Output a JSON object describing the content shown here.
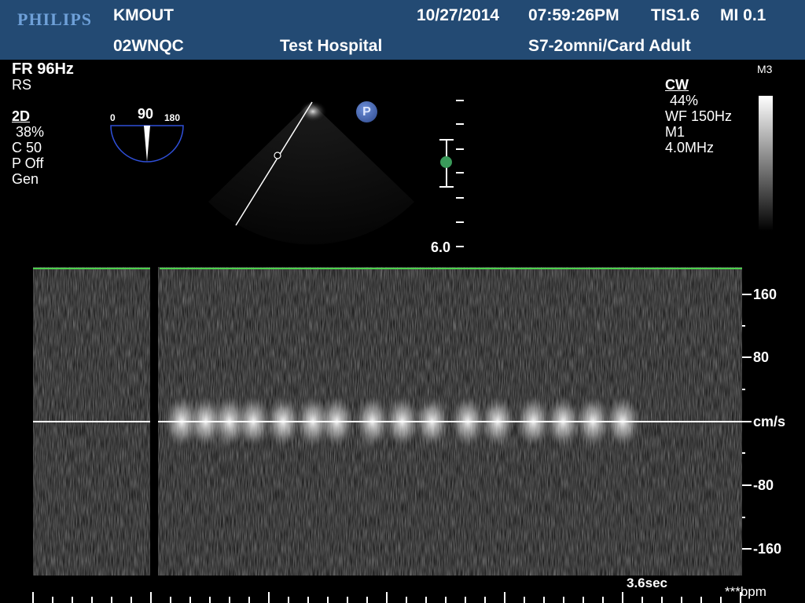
{
  "header": {
    "brand": "PHILIPS",
    "patient_id": "KMOUT",
    "exam_id": "02WNQC",
    "hospital": "Test Hospital",
    "date": "10/27/2014",
    "time": "07:59:26PM",
    "tis": "TIS1.6",
    "mi": "MI 0.1",
    "probe_preset": "S7-2omni/Card Adult"
  },
  "left_panel": {
    "frame_rate": "FR 96Hz",
    "rs": "RS",
    "mode": "2D",
    "gain": "38%",
    "compression": "C 50",
    "persistence": "P Off",
    "resolution": "Gen"
  },
  "angle_indicator": {
    "min": "0",
    "value": "90",
    "max": "180"
  },
  "markers": {
    "p_badge": "P",
    "depth": "6.0",
    "map": "M3"
  },
  "right_panel": {
    "mode": "CW",
    "gain": "44%",
    "wall_filter": "WF 150Hz",
    "map": "M1",
    "frequency": "4.0MHz"
  },
  "velocity_scale": {
    "labels": [
      "160",
      "80",
      "cm/s",
      "-80",
      "-160"
    ],
    "unit": "cm/s"
  },
  "sweep": {
    "time": "3.6sec",
    "heart_rate": "***bpm"
  },
  "colors": {
    "header_bg": "#234a73",
    "brand": "#6ea0d8",
    "baseline": "#ffffff",
    "top_line": "#4cd04c",
    "sample_gate": "#3a9a5a",
    "p_badge": "#3b5fa8"
  },
  "doppler_signal": {
    "baseline_velocity": 0,
    "velocity_range": [
      -200,
      200
    ],
    "bursts": [
      {
        "t": 0.04
      },
      {
        "t": 0.08
      },
      {
        "t": 0.12
      },
      {
        "t": 0.16
      },
      {
        "t": 0.21
      },
      {
        "t": 0.26
      },
      {
        "t": 0.3
      },
      {
        "t": 0.36
      },
      {
        "t": 0.41
      },
      {
        "t": 0.46
      },
      {
        "t": 0.52
      },
      {
        "t": 0.57
      },
      {
        "t": 0.63
      },
      {
        "t": 0.68
      },
      {
        "t": 0.73
      },
      {
        "t": 0.78
      }
    ]
  }
}
